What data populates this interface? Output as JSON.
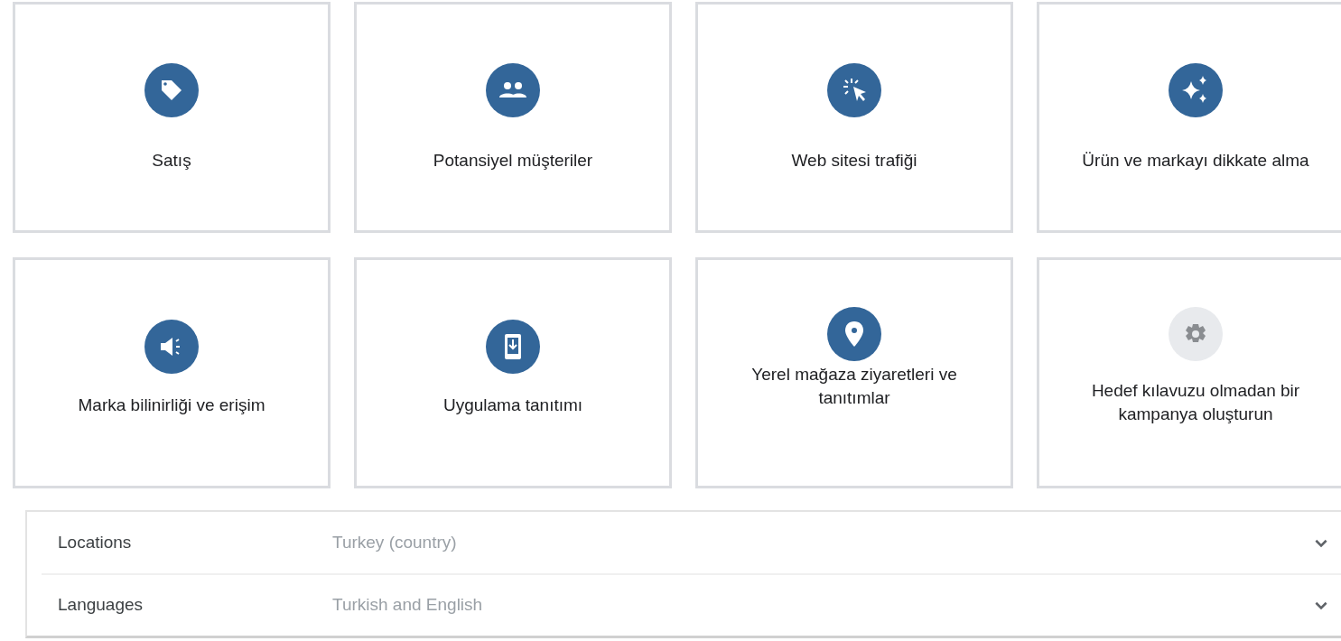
{
  "goals": [
    {
      "label": "Satış",
      "kind": "tag"
    },
    {
      "label": "Potansiyel müşteriler",
      "kind": "people"
    },
    {
      "label": "Web sitesi trafiği",
      "kind": "click"
    },
    {
      "label": "Ürün ve markayı dikkate alma",
      "kind": "sparkle"
    },
    {
      "label": "Marka bilinirliği ve erişim",
      "kind": "megaphone"
    },
    {
      "label": "Uygulama tanıtımı",
      "kind": "phone"
    },
    {
      "label": "Yerel mağaza ziyaretleri ve tanıtımlar",
      "kind": "pin"
    },
    {
      "label": "Hedef kılavuzu olmadan bir kampanya oluşturun",
      "kind": "gear"
    }
  ],
  "settings": [
    {
      "label": "Locations",
      "value": "Turkey (country)",
      "expanded": false
    },
    {
      "label": "Languages",
      "value": "Turkish and English",
      "expanded": false
    }
  ]
}
